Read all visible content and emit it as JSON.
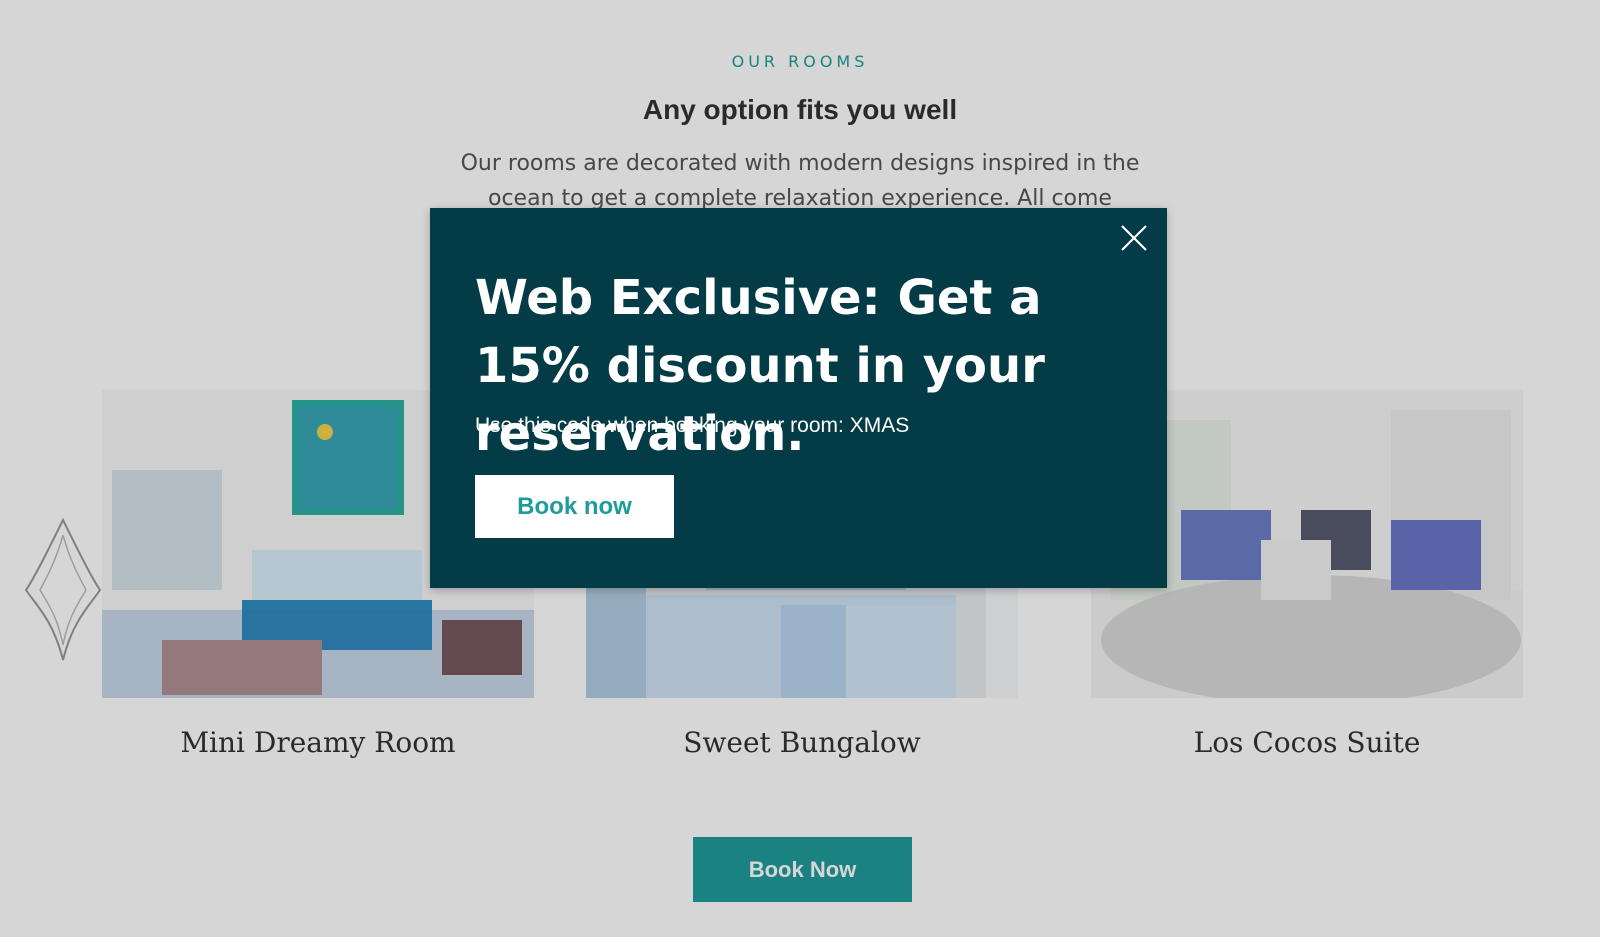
{
  "section": {
    "eyebrow": "OUR ROOMS",
    "heading": "Any option fits you well",
    "intro": "Our rooms are decorated with modern designs inspired in the ocean to get a complete relaxation experience. All come"
  },
  "rooms": [
    {
      "name": "Mini Dreamy Room"
    },
    {
      "name": "Sweet Bungalow"
    },
    {
      "name": "Los Cocos Suite"
    }
  ],
  "page_cta": {
    "label": "Book Now"
  },
  "modal": {
    "title": "Web Exclusive: Get a 15% discount in your reservation.",
    "subtitle": "Use this code when booking your room: XMAS",
    "button": "Book now",
    "close_icon": "close-icon"
  },
  "colors": {
    "accent": "#1f9c9a",
    "modal_bg": "#033b47",
    "overlay": "rgba(0,0,0,0.16)"
  }
}
